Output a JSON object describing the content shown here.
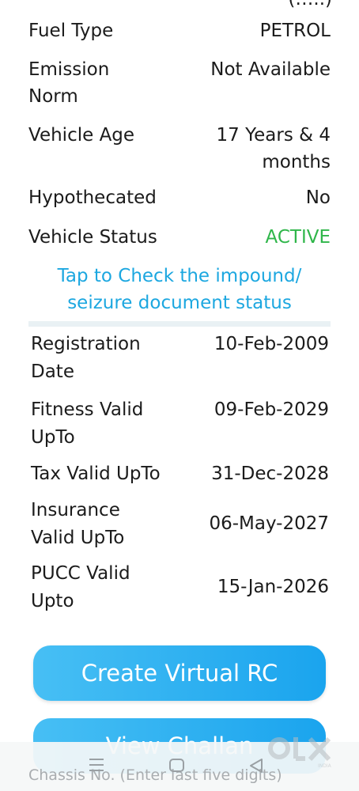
{
  "details_top": [
    {
      "label": "Fuel Type",
      "value": "PETROL"
    },
    {
      "label": "Emission Norm",
      "value": "Not Available"
    },
    {
      "label": "Vehicle Age",
      "value": "17 Years  & 4 months"
    },
    {
      "label": "Hypothecated",
      "value": "No"
    },
    {
      "label": "Vehicle Status",
      "value": "ACTIVE"
    }
  ],
  "status_color": "#2fb64a",
  "link_text": "Tap to Check the impound/ seizure document status",
  "details_dates": [
    {
      "label": "Registration Date",
      "value": "10-Feb-2009"
    },
    {
      "label": "Fitness Valid UpTo",
      "value": "09-Feb-2029"
    },
    {
      "label": "Tax Valid UpTo",
      "value": "31-Dec-2028"
    },
    {
      "label": "Insurance Valid UpTo",
      "value": "06-May-2027"
    },
    {
      "label": "PUCC Valid Upto",
      "value": "15-Jan-2026"
    }
  ],
  "buttons": {
    "create_rc": "Create Virtual RC",
    "view_challan": "View Challan"
  },
  "search_placeholder": "Chassis No. (Enter last five digits)",
  "navbar": {
    "icons": [
      "menu-icon",
      "home-icon",
      "back-icon"
    ]
  },
  "watermark": {
    "text": "OLX",
    "sub": "INDIA"
  },
  "accent_color": "#1ca7e0"
}
